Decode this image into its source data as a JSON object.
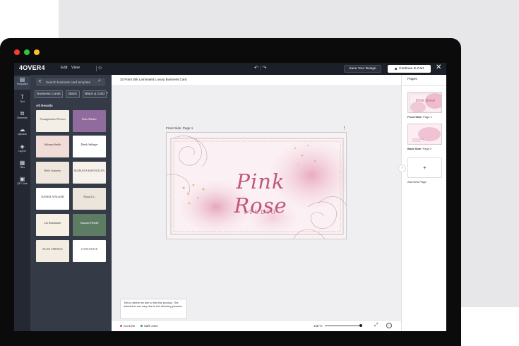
{
  "window": {
    "traffic_lights": [
      "#ff3b30",
      "#28c840",
      "#ffbd2e"
    ]
  },
  "topbar": {
    "logo": "4OVER4",
    "menu_edit": "Edit",
    "menu_view": "View",
    "undo_icon": "↶",
    "redo_icon": "↷",
    "save_label": "Save Your Design",
    "cart_label": "Continue to Cart",
    "close_icon": "✕"
  },
  "rail": {
    "items": [
      {
        "label": "Templates",
        "icon": "▤"
      },
      {
        "label": "Text",
        "icon": "T"
      },
      {
        "label": "Elements",
        "icon": "⧉"
      },
      {
        "label": "Uploads",
        "icon": "☁"
      },
      {
        "label": "Layers",
        "icon": "◈"
      },
      {
        "label": "Tiles",
        "icon": "▦"
      },
      {
        "label": "QR Code",
        "icon": "▣"
      }
    ]
  },
  "templates": {
    "search_placeholder": "Search business card template",
    "chips": [
      "Business Cards",
      "Black",
      "Black & Gold"
    ],
    "all_results": "All Results",
    "thumbs": [
      {
        "title": "Arrangements Flowers",
        "bg": "#f4efe6",
        "fg": "#3b3b3b"
      },
      {
        "title": "Rose Marker",
        "bg": "#8f6b9e",
        "fg": "#ffffff"
      },
      {
        "title": "Julianna Smith",
        "bg": "#f0ddd8",
        "fg": "#4b2e2e"
      },
      {
        "title": "Derek Salinger",
        "bg": "#ffffff",
        "fg": "#222222"
      },
      {
        "title": "Belle Sonnette",
        "bg": "#efe6dd",
        "fg": "#5a3d3d"
      },
      {
        "title": "MARIANA HAPOUTIAN",
        "bg": "#f7f1ec",
        "fg": "#4a3f3f"
      },
      {
        "title": "DANIEL WALKER",
        "bg": "#ffffff",
        "fg": "#333333"
      },
      {
        "title": "Floral Co.",
        "bg": "#ebe5dc",
        "fg": "#333333"
      },
      {
        "title": "Liz Rosemarie",
        "bg": "#f5efe4",
        "fg": "#333333"
      },
      {
        "title": "Suzanne Hendel",
        "bg": "#5e7b64",
        "fg": "#ffffff"
      },
      {
        "title": "ELISE SPRINGS",
        "bg": "#f3ece3",
        "fg": "#5a4a3a"
      },
      {
        "title": "CONSTANCE",
        "bg": "#ffffff",
        "fg": "#5a4a3a"
      }
    ]
  },
  "canvas": {
    "product_title": "32 Point Silk Laminated Luxury Business Card",
    "side_label": "Front Side: Page 1",
    "card_title": "Pink Rose",
    "card_subtitle": "STUDIO",
    "kebab_icon": "⋮",
    "note": "This is where we aim to trim the product. The actual line can vary due to the trimming process.",
    "cut_line": "Cut Line",
    "safe_zone": "Safe zone",
    "zoom": "125 %",
    "expand_icon": "⤢",
    "info_icon": "i"
  },
  "pages": {
    "header": "Pages",
    "front_bold": "Front Side:",
    "front_page": "Page 1",
    "back_bold": "Back Side:",
    "back_page": "Page 2",
    "add_label": "Add New Page",
    "add_icon": "+",
    "collapse_icon": "›"
  },
  "colors": {
    "cut_line": "#e0457b",
    "safe_zone": "#2e9e5b",
    "accent": "#c0577a"
  }
}
